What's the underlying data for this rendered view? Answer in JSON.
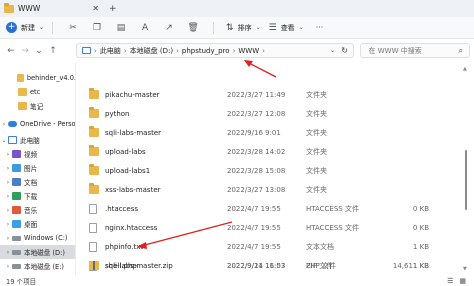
{
  "window": {
    "title": "WWW",
    "tab_close": "✕",
    "tab_add": "+"
  },
  "toolbar": {
    "new_label": "新建",
    "sort_label": "排序",
    "view_label": "查看",
    "more": "···"
  },
  "address": {
    "crumbs": [
      "此电脑",
      "本地磁盘 (D:)",
      "phpstudy_pro",
      "WWW"
    ],
    "sep": "›",
    "search_placeholder": "在 WWW 中搜索"
  },
  "sidebar": {
    "items": [
      {
        "label": "behinder_v4.0.",
        "icon": "folder-icon",
        "arrow": ""
      },
      {
        "label": "etc",
        "icon": "folder-icon",
        "arrow": ""
      },
      {
        "label": "笔记",
        "icon": "folder-icon",
        "arrow": ""
      },
      {
        "label": "OneDrive - Perso",
        "icon": "cloud-icon",
        "arrow": "›"
      },
      {
        "label": "此电脑",
        "icon": "computer-icon",
        "arrow": "⌄"
      },
      {
        "label": "视频",
        "icon": "video-icon",
        "arrow": "›"
      },
      {
        "label": "图片",
        "icon": "picture-icon",
        "arrow": "›"
      },
      {
        "label": "文档",
        "icon": "document-icon",
        "arrow": "›"
      },
      {
        "label": "下载",
        "icon": "download-icon",
        "arrow": "›"
      },
      {
        "label": "音乐",
        "icon": "music-icon",
        "arrow": "›"
      },
      {
        "label": "桌面",
        "icon": "desktop-icon",
        "arrow": "›"
      },
      {
        "label": "Windows (C:)",
        "icon": "drive-icon",
        "arrow": "›"
      },
      {
        "label": "本地磁盘 (D:)",
        "icon": "drive-icon",
        "arrow": "›"
      },
      {
        "label": "本地磁盘 (E:)",
        "icon": "drive-icon",
        "arrow": "›"
      }
    ]
  },
  "files": [
    {
      "name": "pikachu-master",
      "date": "2022/3/27 11:49",
      "type": "文件夹",
      "size": "",
      "kind": "folder"
    },
    {
      "name": "python",
      "date": "2022/3/27 12:08",
      "type": "文件夹",
      "size": "",
      "kind": "folder"
    },
    {
      "name": "sqli-labs-master",
      "date": "2022/9/16 9:01",
      "type": "文件夹",
      "size": "",
      "kind": "folder"
    },
    {
      "name": "upload-labs",
      "date": "2022/3/28 14:02",
      "type": "文件夹",
      "size": "",
      "kind": "folder"
    },
    {
      "name": "upload-labs1",
      "date": "2022/3/28 15:08",
      "type": "文件夹",
      "size": "",
      "kind": "folder"
    },
    {
      "name": "xss-labs-master",
      "date": "2022/3/27 13:08",
      "type": "文件夹",
      "size": "",
      "kind": "folder"
    },
    {
      "name": ".htaccess",
      "date": "2022/4/7 19:55",
      "type": "HTACCESS 文件",
      "size": "0 KB",
      "kind": "file"
    },
    {
      "name": "nginx.htaccess",
      "date": "2022/4/7 19:55",
      "type": "HTACCESS 文件",
      "size": "0 KB",
      "kind": "file"
    },
    {
      "name": "phpinfo.txt",
      "date": "2022/4/7 19:55",
      "type": "文本文档",
      "size": "1 KB",
      "kind": "file"
    },
    {
      "name": "shell.php",
      "date": "2022/9/21 11:07",
      "type": "PHP 文件",
      "size": "1 KB",
      "kind": "file"
    },
    {
      "name": "sqli-labs-master.zip",
      "date": "2022/9/14 16:53",
      "type": "ZIP 文件",
      "size": "14,611 KB",
      "kind": "zip"
    }
  ],
  "status": {
    "count": "19 个项目"
  },
  "colors": {
    "annotation_red": "#e02020",
    "accent": "#2b6fd6"
  }
}
